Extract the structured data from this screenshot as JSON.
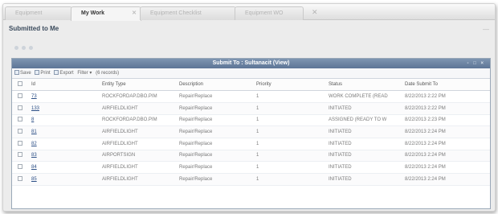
{
  "tabs": [
    {
      "label": "Equipment"
    },
    {
      "label": "My Work"
    },
    {
      "label": "Equipment Checklist"
    },
    {
      "label": "Equipment WO"
    }
  ],
  "page": {
    "title": "Submitted to Me",
    "collapse": "—"
  },
  "grid": {
    "title": "Submit To : Sultanacit (View)",
    "window_controls": "- □ ×",
    "toolbar": {
      "save": "Save",
      "print": "Print",
      "export": "Export",
      "filter": "Filter ▾",
      "period": "(6 records)"
    },
    "columns": {
      "id": "Id",
      "entity_type": "Entity Type",
      "description": "Description",
      "priority": "Priority",
      "status": "Status",
      "date": "Date Submit To"
    },
    "rows": [
      {
        "id": "73",
        "entity_type": "ROCKFORDAP.DBO.PIM",
        "description": "Repair/Replace",
        "priority": "1",
        "status": "WORK COMPLETE (READ",
        "date": "8/22/2013 2:22 PM"
      },
      {
        "id": "133",
        "entity_type": "AIRFIELDLIGHT",
        "description": "Repair/Replace",
        "priority": "1",
        "status": "INITIATED",
        "date": "8/22/2013 2:22 PM"
      },
      {
        "id": "8",
        "entity_type": "ROCKFORDAP.DBO.PIM",
        "description": "Repair/Replace",
        "priority": "1",
        "status": "ASSIGNED (READY TO W",
        "date": "8/22/2013 2:23 PM"
      },
      {
        "id": "81",
        "entity_type": "AIRFIELDLIGHT",
        "description": "Repair/Replace",
        "priority": "1",
        "status": "INITIATED",
        "date": "8/22/2013 2:24 PM"
      },
      {
        "id": "82",
        "entity_type": "AIRFIELDLIGHT",
        "description": "Repair/Replace",
        "priority": "1",
        "status": "INITIATED",
        "date": "8/22/2013 2:24 PM"
      },
      {
        "id": "83",
        "entity_type": "AIRPORTSIGN",
        "description": "Repair/Replace",
        "priority": "1",
        "status": "INITIATED",
        "date": "8/22/2013 2:24 PM"
      },
      {
        "id": "84",
        "entity_type": "AIRFIELDLIGHT",
        "description": "Repair/Replace",
        "priority": "1",
        "status": "INITIATED",
        "date": "8/22/2013 2:24 PM"
      },
      {
        "id": "85",
        "entity_type": "AIRFIELDLIGHT",
        "description": "Repair/Replace",
        "priority": "1",
        "status": "INITIATED",
        "date": "8/22/2013 2:24 PM"
      }
    ]
  }
}
